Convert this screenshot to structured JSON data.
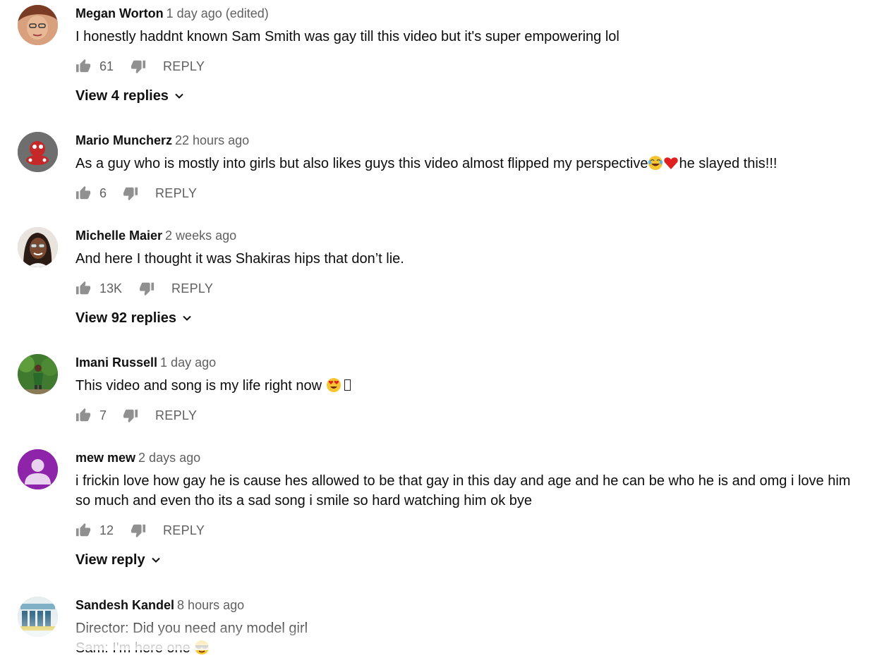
{
  "comments": [
    {
      "author": "Megan Worton",
      "time": "1 day ago (edited)",
      "text": "I honestly haddnt known Sam Smith was gay till this video but it's super empowering lol",
      "likes": "61",
      "reply_label": "REPLY",
      "view_replies": "View 4 replies"
    },
    {
      "author": "Mario Muncherz",
      "time": "22 hours ago",
      "text_before_emoji": "As a guy who is mostly into girls but also likes guys this video almost flipped my perspective",
      "text_after_emoji": "he slayed this!!!",
      "likes": "6",
      "reply_label": "REPLY"
    },
    {
      "author": "Michelle Maier",
      "time": "2 weeks ago",
      "text": "And here I thought it was Shakiras hips that don’t lie.",
      "likes": "13K",
      "reply_label": "REPLY",
      "view_replies": "View 92 replies"
    },
    {
      "author": "Imani Russell",
      "time": "1 day ago",
      "text": "This video and song is my life right now",
      "likes": "7",
      "reply_label": "REPLY"
    },
    {
      "author": "mew mew",
      "time": "2 days ago",
      "text_line1": "i frickin love how gay he is cause hes allowed to be that gay in this day and age and he can be who he is and omg i love him",
      "text_line2": "so much and even tho its a sad song i smile so hard watching him ok bye",
      "likes": "12",
      "reply_label": "REPLY",
      "view_replies": "View reply"
    },
    {
      "author": "Sandesh Kandel",
      "time": "8 hours ago",
      "text_line1": "Director: Did you need any model girl",
      "text_line2": "Sam: I'm here one"
    }
  ],
  "colors": {
    "text": "#0d0d0d",
    "meta": "#606060",
    "avatar_purple": "#8e24aa"
  },
  "icons": [
    "thumbs-up-icon",
    "thumbs-down-icon",
    "chevron-down-icon",
    "tears-of-joy-emoji",
    "red-heart-emoji",
    "heart-eyes-emoji",
    "sunglasses-emoji"
  ]
}
